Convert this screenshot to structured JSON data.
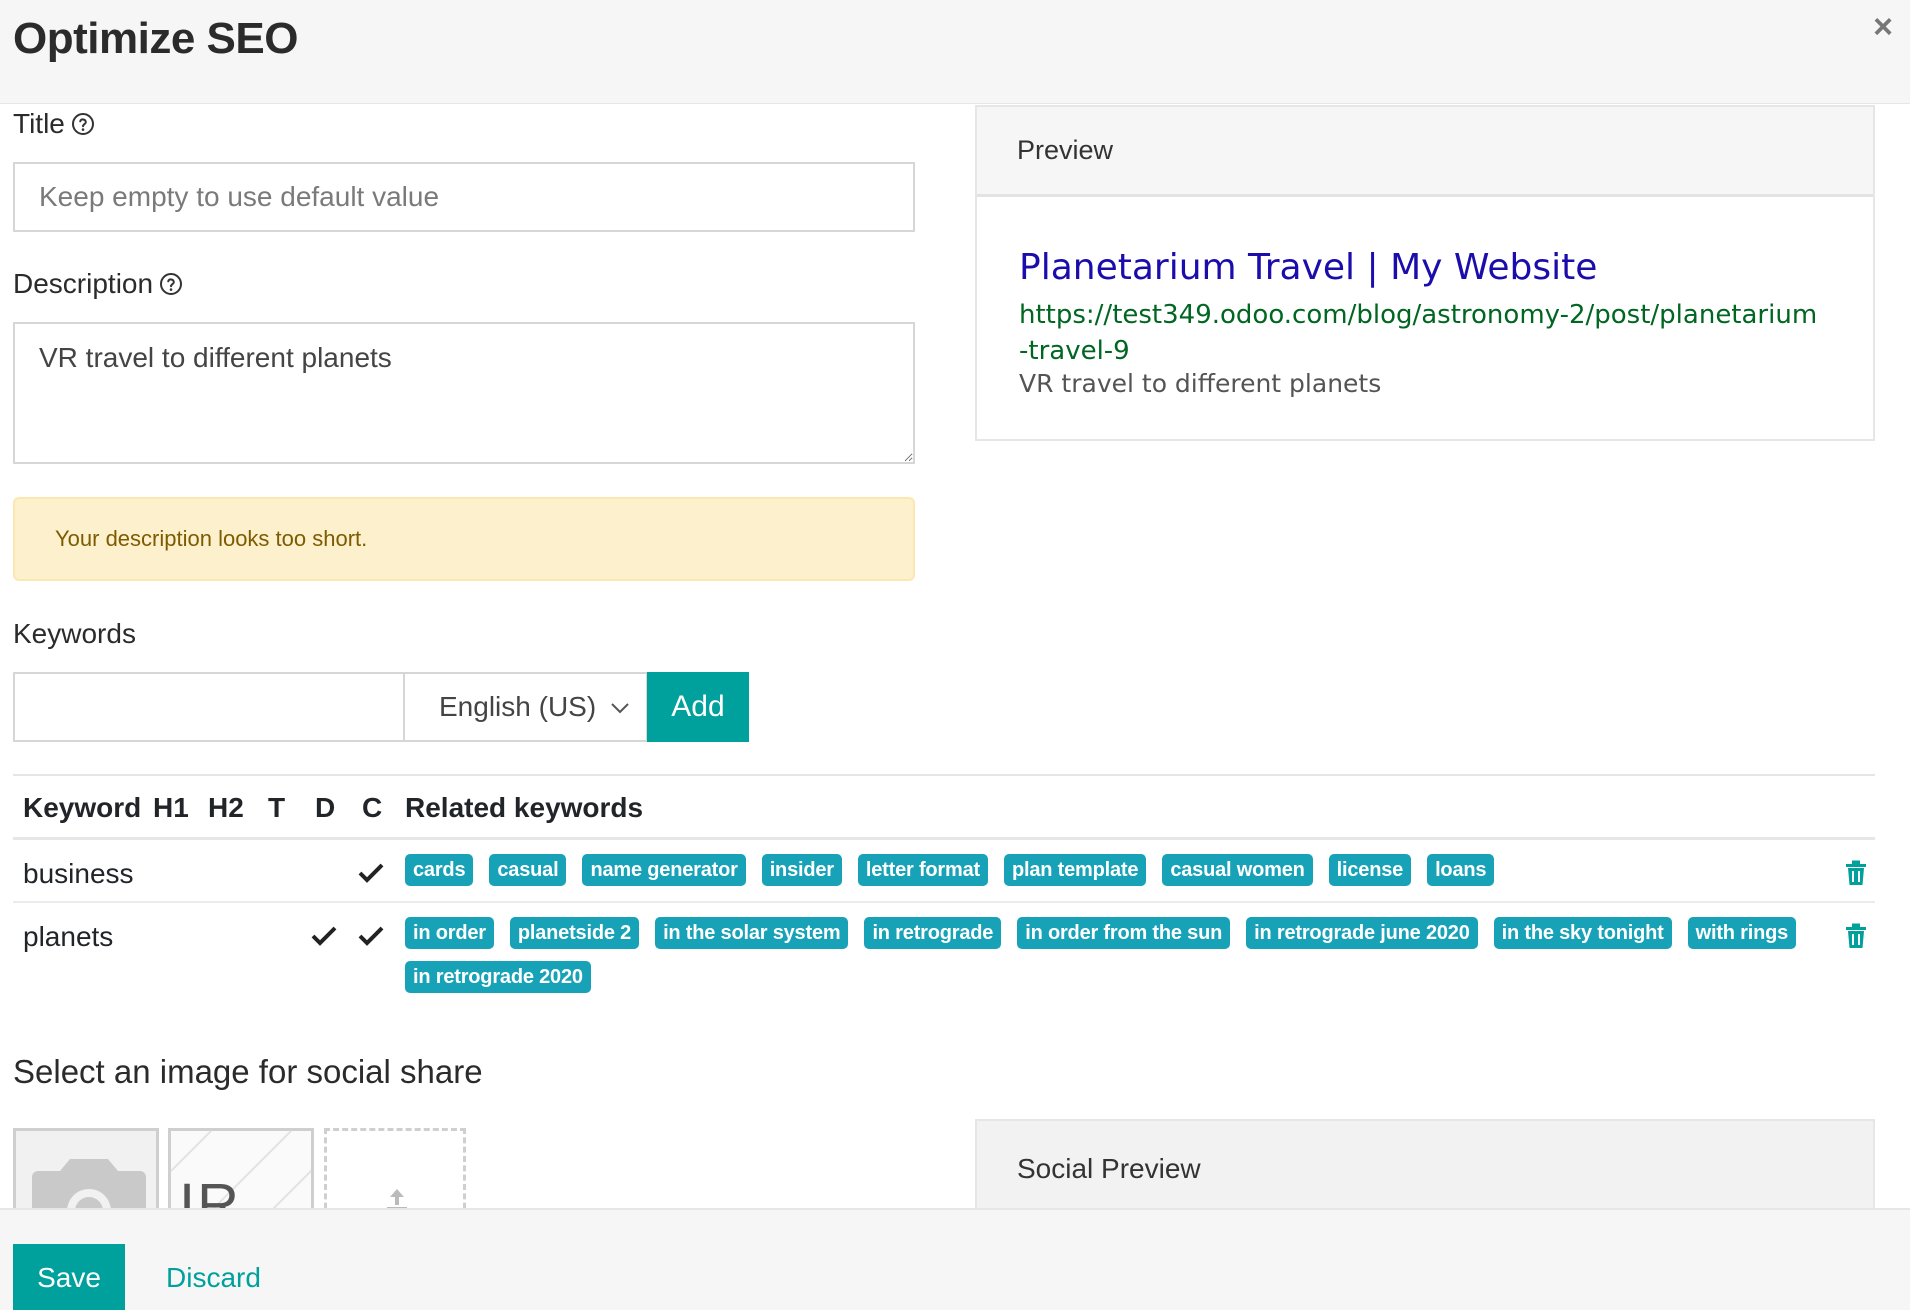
{
  "modal": {
    "title": "Optimize SEO",
    "close_icon": "close-icon"
  },
  "form": {
    "title_label": "Title",
    "title_placeholder": "Keep empty to use default value",
    "title_value": "",
    "description_label": "Description",
    "description_value": "VR travel to different planets",
    "description_warning": "Your description looks too short.",
    "keywords_label": "Keywords",
    "keyword_input_value": "",
    "language_selected": "English (US)",
    "add_label": "Add"
  },
  "keyword_table": {
    "headers": [
      "Keyword",
      "H1",
      "H2",
      "T",
      "D",
      "C",
      "Related keywords"
    ],
    "rows": [
      {
        "keyword": "business",
        "h1": false,
        "h2": false,
        "t": false,
        "d": false,
        "c": true,
        "related": [
          "cards",
          "casual",
          "name generator",
          "insider",
          "letter format",
          "plan template",
          "casual women",
          "license",
          "loans"
        ]
      },
      {
        "keyword": "planets",
        "h1": false,
        "h2": false,
        "t": false,
        "d": true,
        "c": true,
        "related": [
          "in order",
          "planetside 2",
          "in the solar system",
          "in retrograde",
          "in order from the sun",
          "in retrograde june 2020",
          "in the sky tonight",
          "with rings",
          "in retrograde 2020"
        ]
      }
    ]
  },
  "social": {
    "section_title": "Select an image for social share",
    "thumb_text": "IR W",
    "preview_label": "Social Preview"
  },
  "preview": {
    "label": "Preview",
    "serp_title": "Planetarium Travel | My Website",
    "serp_url": "https://test349.odoo.com/blog/astronomy-2/post/planetarium-travel-9",
    "serp_description": "VR travel to different planets"
  },
  "footer": {
    "save_label": "Save",
    "discard_label": "Discard"
  },
  "colors": {
    "accent": "#00a09d",
    "tag": "#17a2b8",
    "serp_title": "#1a0dab",
    "serp_url": "#006621",
    "warning_bg": "#fdf1cd"
  }
}
